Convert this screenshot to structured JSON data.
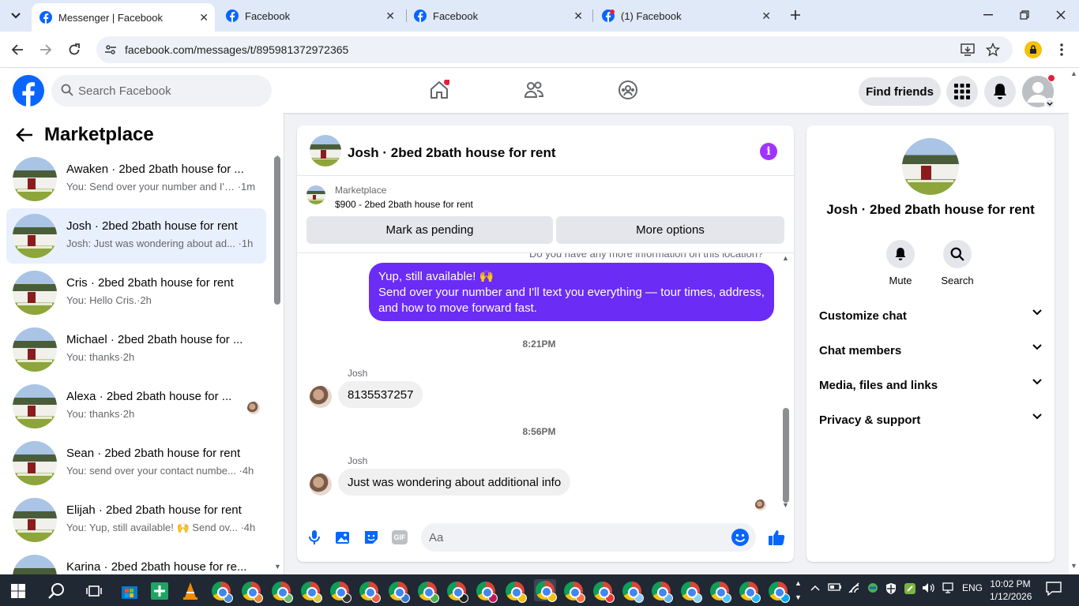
{
  "browser": {
    "tabs": [
      {
        "title": "Messenger | Facebook",
        "active": true
      },
      {
        "title": "Facebook",
        "active": false
      },
      {
        "title": "Facebook",
        "active": false
      },
      {
        "title": "(1) Facebook",
        "active": false
      }
    ],
    "url": "facebook.com/messages/t/895981372972365"
  },
  "fb_header": {
    "search_placeholder": "Search Facebook",
    "find_friends_label": "Find friends",
    "brand_color": "#0866ff"
  },
  "sidebar": {
    "title": "Marketplace",
    "conversations": [
      {
        "name": "Awaken · 2bed 2bath house for ...",
        "preview": "You: Send over your number and I'… ·1m",
        "active": false
      },
      {
        "name": "Josh · 2bed 2bath house for rent",
        "preview": "Josh: Just was wondering about ad... ·1h",
        "active": true
      },
      {
        "name": "Cris · 2bed 2bath house for rent",
        "preview": "You: Hello Cris.·2h",
        "active": false
      },
      {
        "name": "Michael · 2bed 2bath house for ...",
        "preview": "You: thanks·2h",
        "active": false
      },
      {
        "name": "Alexa · 2bed 2bath house for ...",
        "preview": "You: thanks·2h",
        "active": false
      },
      {
        "name": "Sean · 2bed 2bath house for rent",
        "preview": "You: send over your contact numbe... ·4h",
        "active": false
      },
      {
        "name": "Elijah · 2bed 2bath house for rent",
        "preview": "You: Yup, still available! 🙌 Send ov... ·4h",
        "active": false
      },
      {
        "name": "Karina · 2bed 2bath house for re...",
        "preview": "",
        "active": false
      }
    ]
  },
  "chat": {
    "title": "Josh · 2bed 2bath house for rent",
    "marketplace_label": "Marketplace",
    "listing": "$900 - 2bed 2bath house for rent",
    "mark_pending_label": "Mark as pending",
    "more_options_label": "More options",
    "cut_text": "Do you have any more information on this location?",
    "outgoing_line1": "Yup, still available! 🙌",
    "outgoing_line2": "Send over your number and I'll text you everything — tour times, address, and how to move forward fast.",
    "time1": "8:21PM",
    "sender1": "Josh",
    "msg1": "8135537257",
    "time2": "8:56PM",
    "sender2": "Josh",
    "msg2": "Just was wondering about additional info",
    "composer_placeholder": "Aa",
    "accent_color": "#6b2cf5"
  },
  "details": {
    "name": "Josh · 2bed 2bath house for rent",
    "mute_label": "Mute",
    "search_label": "Search",
    "sections": [
      "Customize chat",
      "Chat members",
      "Media, files and links",
      "Privacy & support"
    ]
  },
  "taskbar": {
    "lang": "ENG",
    "time": "10:02 PM",
    "date": "1/12/2026"
  }
}
